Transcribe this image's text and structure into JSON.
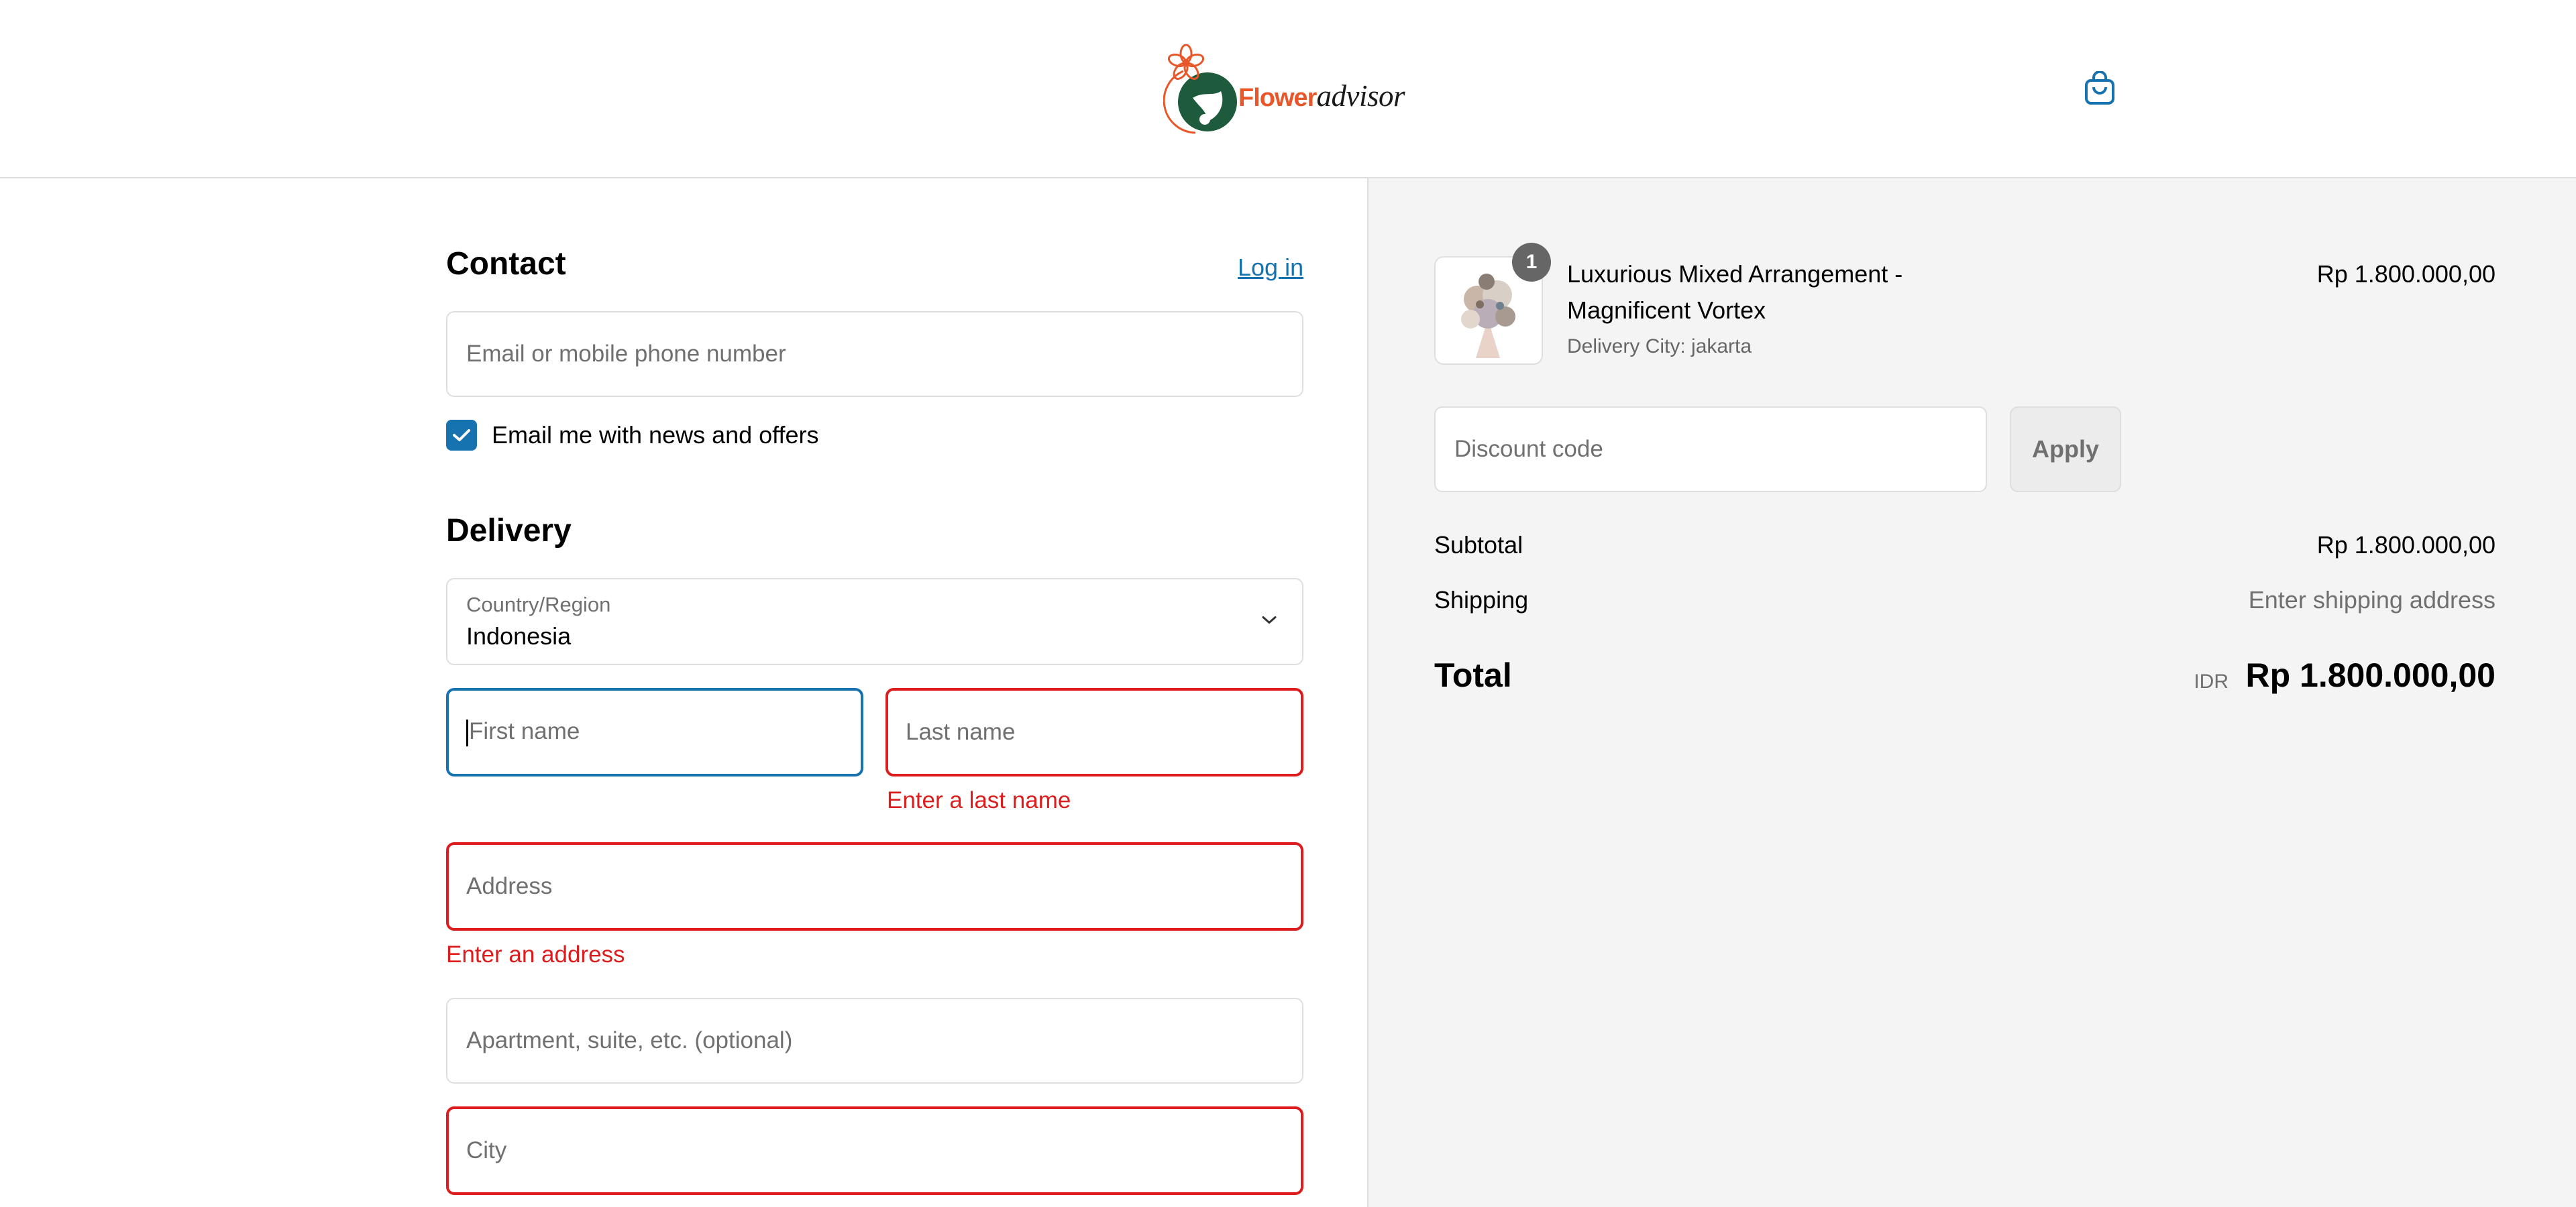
{
  "header": {
    "logo_text_brand": "Flower",
    "logo_text_suffix": "advisor",
    "cart_icon": "shopping-bag-icon"
  },
  "colors": {
    "accent": "#1773b0",
    "error": "#dd1d1d",
    "brand_orange": "#e8572a",
    "brand_green": "#1e5b3c",
    "summary_bg": "#f4f4f4"
  },
  "contact": {
    "title": "Contact",
    "login_link": "Log in",
    "email_placeholder": "Email or mobile phone number",
    "newsletter_label": "Email me with news and offers",
    "newsletter_checked": true
  },
  "delivery": {
    "title": "Delivery",
    "country_label": "Country/Region",
    "country_value": "Indonesia",
    "first_name_placeholder": "First name",
    "last_name_placeholder": "Last name",
    "last_name_error": "Enter a last name",
    "address_placeholder": "Address",
    "address_error": "Enter an address",
    "apartment_placeholder": "Apartment, suite, etc. (optional)",
    "city_placeholder": "City"
  },
  "summary": {
    "product": {
      "quantity": "1",
      "title": "Luxurious Mixed Arrangement - Magnificent Vortex",
      "subtitle": "Delivery City: jakarta",
      "price": "Rp 1.800.000,00"
    },
    "discount_placeholder": "Discount code",
    "apply_label": "Apply",
    "subtotal_label": "Subtotal",
    "subtotal_value": "Rp 1.800.000,00",
    "shipping_label": "Shipping",
    "shipping_value": "Enter shipping address",
    "total_label": "Total",
    "total_currency": "IDR",
    "total_value": "Rp 1.800.000,00"
  }
}
